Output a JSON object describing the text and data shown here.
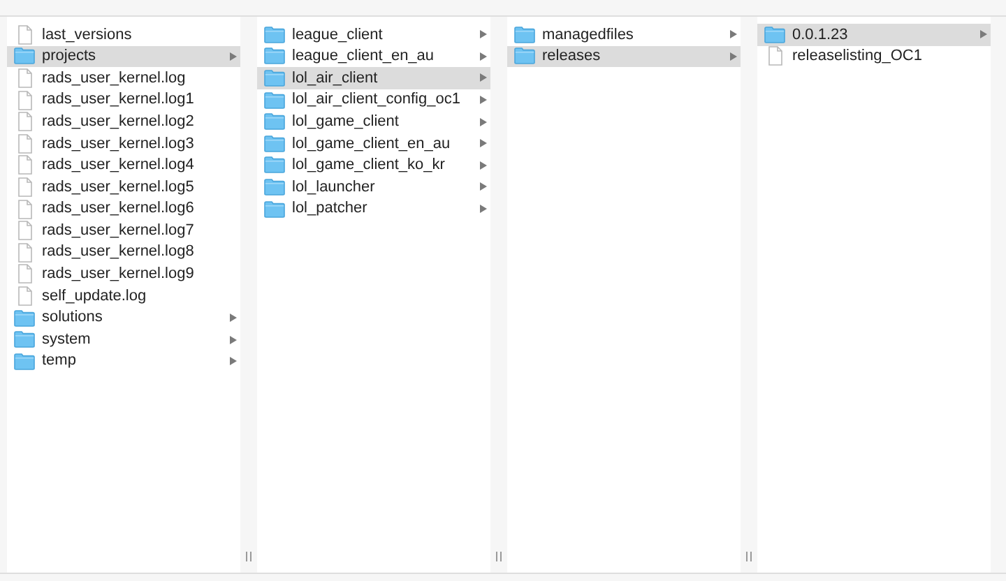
{
  "columns": [
    {
      "items": [
        {
          "name": "last_versions",
          "kind": "file",
          "selected": false
        },
        {
          "name": "projects",
          "kind": "folder",
          "selected": true
        },
        {
          "name": "rads_user_kernel.log",
          "kind": "file",
          "selected": false
        },
        {
          "name": "rads_user_kernel.log1",
          "kind": "file",
          "selected": false
        },
        {
          "name": "rads_user_kernel.log2",
          "kind": "file",
          "selected": false
        },
        {
          "name": "rads_user_kernel.log3",
          "kind": "file",
          "selected": false
        },
        {
          "name": "rads_user_kernel.log4",
          "kind": "file",
          "selected": false
        },
        {
          "name": "rads_user_kernel.log5",
          "kind": "file",
          "selected": false
        },
        {
          "name": "rads_user_kernel.log6",
          "kind": "file",
          "selected": false
        },
        {
          "name": "rads_user_kernel.log7",
          "kind": "file",
          "selected": false
        },
        {
          "name": "rads_user_kernel.log8",
          "kind": "file",
          "selected": false
        },
        {
          "name": "rads_user_kernel.log9",
          "kind": "file",
          "selected": false
        },
        {
          "name": "self_update.log",
          "kind": "file",
          "selected": false
        },
        {
          "name": "solutions",
          "kind": "folder",
          "selected": false
        },
        {
          "name": "system",
          "kind": "folder",
          "selected": false
        },
        {
          "name": "temp",
          "kind": "folder",
          "selected": false
        }
      ]
    },
    {
      "items": [
        {
          "name": "league_client",
          "kind": "folder",
          "selected": false
        },
        {
          "name": "league_client_en_au",
          "kind": "folder",
          "selected": false
        },
        {
          "name": "lol_air_client",
          "kind": "folder",
          "selected": true
        },
        {
          "name": "lol_air_client_config_oc1",
          "kind": "folder",
          "selected": false
        },
        {
          "name": "lol_game_client",
          "kind": "folder",
          "selected": false
        },
        {
          "name": "lol_game_client_en_au",
          "kind": "folder",
          "selected": false
        },
        {
          "name": "lol_game_client_ko_kr",
          "kind": "folder",
          "selected": false
        },
        {
          "name": "lol_launcher",
          "kind": "folder",
          "selected": false
        },
        {
          "name": "lol_patcher",
          "kind": "folder",
          "selected": false
        }
      ]
    },
    {
      "items": [
        {
          "name": "managedfiles",
          "kind": "folder",
          "selected": false
        },
        {
          "name": "releases",
          "kind": "folder",
          "selected": true
        }
      ]
    },
    {
      "items": [
        {
          "name": "0.0.1.23",
          "kind": "folder",
          "selected": true
        },
        {
          "name": "releaselisting_OC1",
          "kind": "file",
          "selected": false
        }
      ]
    }
  ]
}
